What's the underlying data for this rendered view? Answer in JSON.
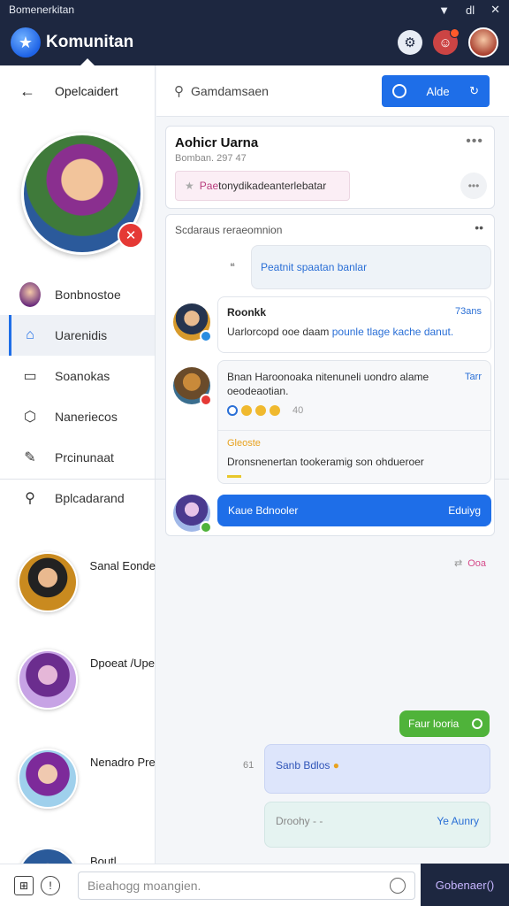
{
  "status_bar": {
    "title": "Bomenerkitan",
    "icons": [
      "wifi-icon",
      "battery-icon",
      "close-icon"
    ],
    "battery_label": "dl"
  },
  "app_bar": {
    "title": "Komunitan",
    "icons": [
      "logo-icon",
      "settings-icon",
      "notification-icon",
      "profile-avatar"
    ]
  },
  "sidebar": {
    "header": "Opelcaidert",
    "nav": [
      {
        "label": "Bonbnostoe",
        "icon": "avatar"
      },
      {
        "label": "Uarenidis",
        "icon": "home-icon",
        "active": true
      },
      {
        "label": "Soanokas",
        "icon": "chat-icon"
      },
      {
        "label": "Naneriecos",
        "icon": "shield-icon"
      },
      {
        "label": "Prcinunaat",
        "icon": "feather-icon"
      },
      {
        "label": "Bplcadarand",
        "icon": "search-icon"
      }
    ],
    "friends": [
      {
        "name": "Sanal Eonde"
      },
      {
        "name": "Dpoeat /Upe"
      },
      {
        "name": "Nenadro Pre"
      },
      {
        "name": "Boutl"
      }
    ]
  },
  "search": {
    "placeholder": "Gamdamsaen",
    "button_label": "Alde"
  },
  "profile_card": {
    "title": "Aohicr Uarna",
    "subtitle": "Bomban.  297 47",
    "tag_pink": "Pae",
    "tag_text": "tonydikadeanterlebatar"
  },
  "feed": {
    "header": "Scdaraus reraeomnion",
    "first_message": "Peatnit spaatan banlar",
    "post": {
      "name": "Roonkk",
      "time": "73ans",
      "text": "Uarlorcopd ooe  daam  ",
      "link": "pounle tlage kache danut."
    },
    "comment": {
      "text": "Bnan Haroonoaka nitenuneli uondro alame  oeodeaotian.",
      "time": "Tarr",
      "reaction_count": "40",
      "quote_header": "Gleoste",
      "quote_text": "Dronsnenertan tookeramig son ohdueroer"
    },
    "cta": {
      "left": "Kaue Bdnooler",
      "right": "Eduiyg"
    }
  },
  "chat": {
    "meta": "Ooa",
    "green_pill": "Faur looria",
    "sent_message": "Sanb Bdlos",
    "sent_message_marker": "61",
    "draft_left": "Droohy - -",
    "draft_right": "Ye Aunry"
  },
  "composer": {
    "placeholder": "Bieahogg moangien.",
    "send_label": "Gobenaer()"
  }
}
